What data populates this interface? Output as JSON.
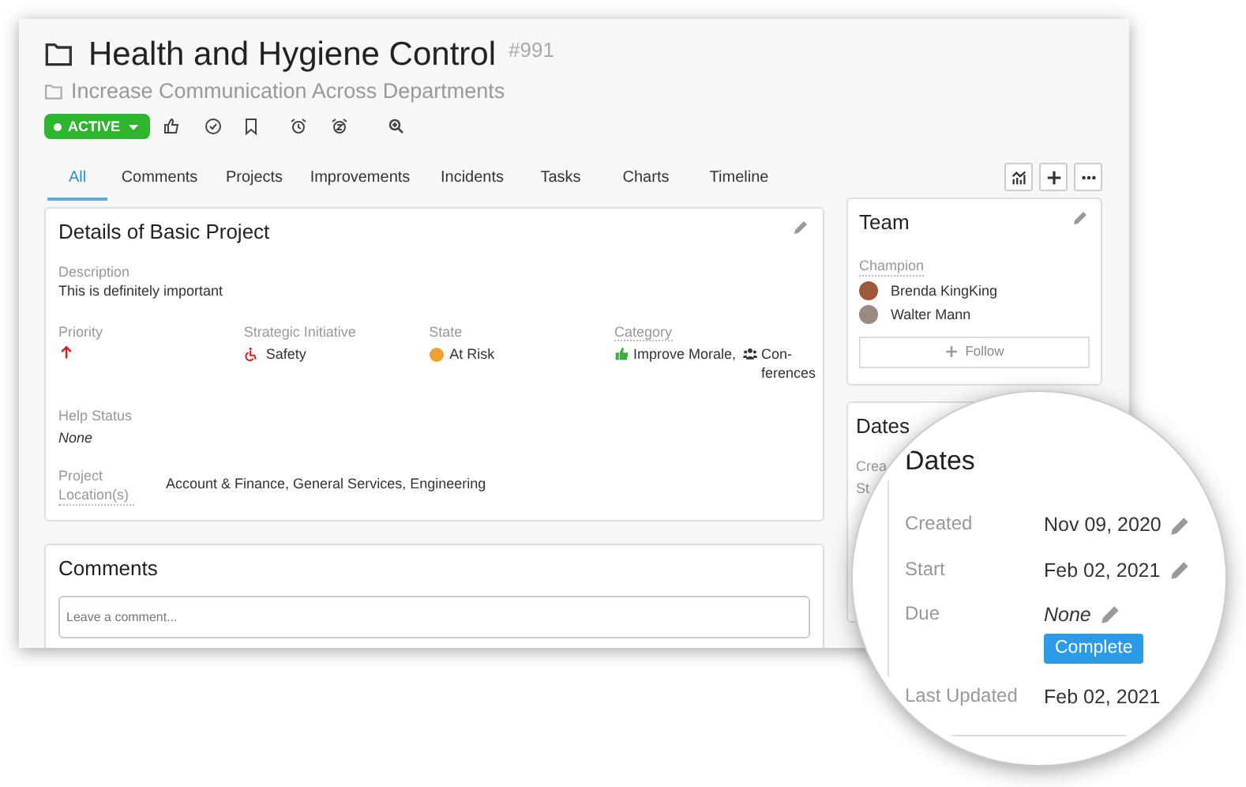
{
  "title": "Health and Hygiene Control",
  "number": "#991",
  "parent": "Increase Communication Across Departments",
  "status": {
    "label": "ACTIVE"
  },
  "tabs": [
    {
      "label": "All",
      "selected": true
    },
    {
      "label": "Comments",
      "selected": false
    },
    {
      "label": "Projects",
      "selected": false
    },
    {
      "label": "Improvements",
      "selected": false
    },
    {
      "label": "Incidents",
      "selected": false
    },
    {
      "label": "Tasks",
      "selected": false
    },
    {
      "label": "Charts",
      "selected": false
    },
    {
      "label": "Timeline",
      "selected": false
    }
  ],
  "details": {
    "title": "Details of Basic Project",
    "description": {
      "label": "Description",
      "value": "This is definitely important"
    },
    "columns": [
      {
        "kind": "priority",
        "label": "Priority"
      },
      {
        "kind": "initiative",
        "label": "Strategic Initiative",
        "value": "Safety"
      },
      {
        "kind": "state",
        "label": "State",
        "value": "At Risk",
        "color": "#f0a030"
      },
      {
        "kind": "category",
        "label": "Category",
        "values": [
          "Improve Morale,",
          "Con-ferences"
        ]
      }
    ],
    "help_status": {
      "label": "Help Status",
      "value": "None"
    },
    "locations": {
      "label": "Project Location(s)",
      "value": "Account & Finance, General Services, Engineering"
    }
  },
  "team": {
    "title": "Team",
    "role": "Champion",
    "people": [
      {
        "name": "Brenda KingKing"
      },
      {
        "name": "Walter Mann"
      }
    ],
    "follow": "Follow"
  },
  "dates_card": {
    "title": "Dates",
    "labels": [
      "Crea",
      "St"
    ]
  },
  "magnified_dates": {
    "title": "Dates",
    "rows": [
      {
        "label": "Created",
        "value": "Nov 09, 2020",
        "editable": true,
        "empty": false
      },
      {
        "label": "Start",
        "value": "Feb 02, 2021",
        "editable": true,
        "empty": false
      },
      {
        "label": "Due",
        "value": "None",
        "editable": true,
        "empty": true,
        "action": "Complete"
      },
      {
        "label": "Last Updated",
        "value": "Feb 02, 2021",
        "editable": false,
        "empty": false
      }
    ]
  },
  "comments": {
    "title": "Comments",
    "placeholder": "Leave a comment..."
  }
}
